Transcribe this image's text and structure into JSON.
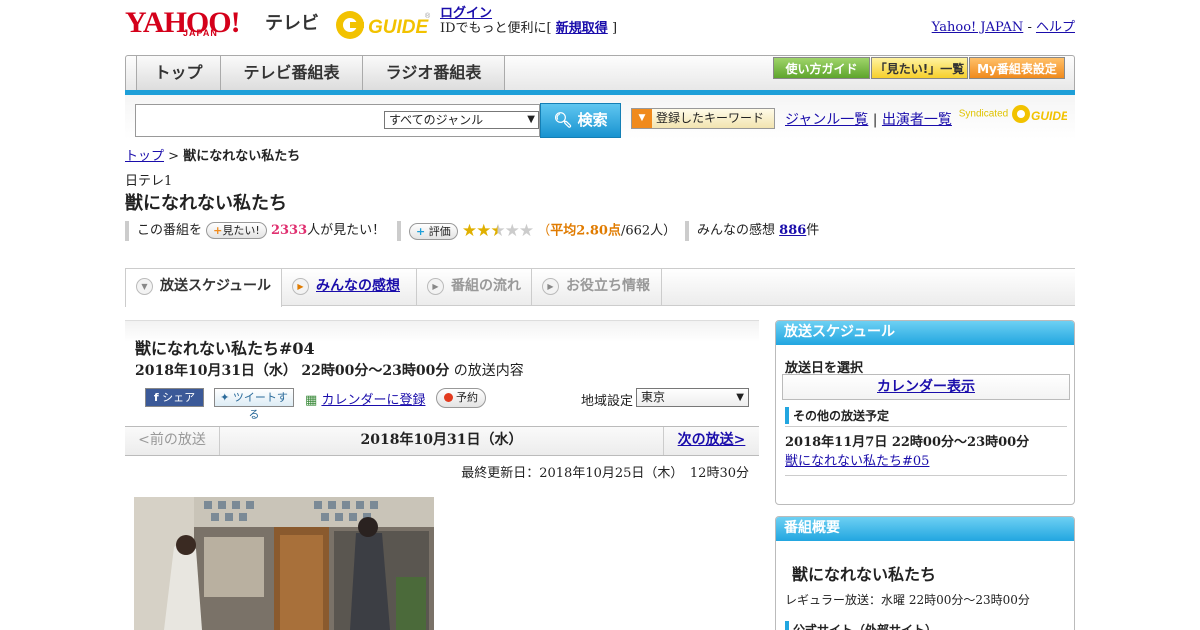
{
  "header": {
    "logo_yahoo": "YAHOO!",
    "logo_japan": "JAPAN",
    "logo_tv": "テレビ",
    "gguide_logo": "G GUIDE",
    "login_label": "ログイン",
    "login_prompt": "IDでもっと便利に[",
    "register_label": "新規取得",
    "login_prompt_end": "]",
    "yahoo_japan_link": "Yahoo! JAPAN",
    "separator": "-",
    "help_link": "ヘルプ"
  },
  "nav": {
    "tabs": [
      {
        "label": "トップ"
      },
      {
        "label": "テレビ番組表"
      },
      {
        "label": "ラジオ番組表"
      }
    ],
    "guide_label": "使い方ガイド",
    "watchlist_label": "「見たい!」一覧",
    "my_schedule_label": "My番組表設定"
  },
  "search": {
    "placeholder": "",
    "genre_selected": "すべてのジャンル",
    "search_button": "検索",
    "keyword_button": "登録したキーワード",
    "genre_list_link": "ジャンル一覧",
    "divider": "|",
    "performer_list_link": "出演者一覧",
    "syndicated_label": "Syndicated",
    "syndicated_logo": "G GUIDE"
  },
  "breadcrumb": {
    "top": "トップ",
    "sep": ">",
    "current": "獣になれない私たち"
  },
  "program": {
    "channel": "日テレ1",
    "title": "獣になれない私たち",
    "want_prefix": "この番組を",
    "want_button": "見たい!",
    "want_count": "2333",
    "want_suffix": "人が見たい！",
    "rate_button": "評価",
    "stars_filled": 2.5,
    "rating_open": "（",
    "rating_avg": "平均2.80点",
    "rating_count": "/662人）",
    "reviews_label": "みんなの感想",
    "reviews_count": "886",
    "reviews_suffix": "件"
  },
  "tabs": [
    {
      "label": "放送スケジュール"
    },
    {
      "label": "みんなの感想"
    },
    {
      "label": "番組の流れ"
    },
    {
      "label": "お役立ち情報"
    }
  ],
  "episode": {
    "title": "獣になれない私たち#04",
    "broadcast_date": "2018年10月31日（水）",
    "broadcast_time": "22時00分～23時00分",
    "broadcast_suffix": "の放送内容",
    "share_label": "シェア",
    "tweet_label": "ツイートする",
    "calendar_label": "カレンダーに登録",
    "reserve_label": "予約",
    "region_label": "地域設定",
    "region_selected": "東京",
    "prev_label": "<前の放送",
    "current_date": "2018年10月31日（水）",
    "next_label": "次の放送>",
    "updated": "最終更新日：2018年10月25日（木）　12時30分"
  },
  "sidebar": {
    "schedule_title": "放送スケジュール",
    "select_date": "放送日を選択",
    "calendar_button": "カレンダー表示",
    "other_title": "その他の放送予定",
    "other_date": "2018年11月7日 22時00分～23時00分",
    "other_link": "獣になれない私たち#05",
    "overview_title": "番組概要",
    "overview_program": "獣になれない私たち",
    "overview_regular": "レギュラー放送：水曜 22時00分～23時00分",
    "overview_official": "公式サイト（外部サイト）"
  },
  "colors": {
    "brand_red": "#d4001a",
    "accent_blue": "#1e9fd8",
    "link": "#1a0dab",
    "want_pink": "#e03070",
    "rating_orange": "#e07b00"
  }
}
